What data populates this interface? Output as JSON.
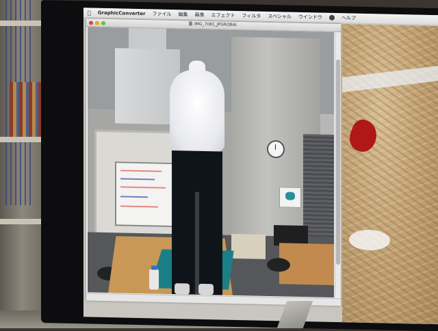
{
  "menubar": {
    "app_name": "GraphicConverter",
    "items": [
      "ファイル",
      "編集",
      "画像",
      "エフェクト",
      "フィルタ",
      "スペシャル",
      "ウインドウ",
      "ヘルプ"
    ]
  },
  "document_window": {
    "title": "IMG_7081_JPGROBAI"
  },
  "colors": {
    "bezel": "#0d0d0f",
    "close": "#e0443e",
    "minimize": "#e2a631",
    "zoom": "#5ec43a",
    "teal_mat": "#1d7f86"
  }
}
